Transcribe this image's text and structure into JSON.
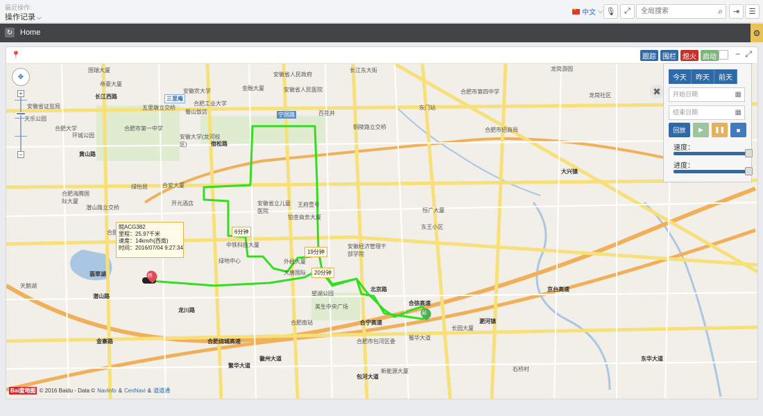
{
  "topbar": {
    "recent_label": "最近操作:",
    "op_log": "操作记录",
    "lang": "中文",
    "search_placeholder": "全局搜索"
  },
  "tabbar": {
    "home": "Home"
  },
  "panel": {
    "buttons": {
      "track": "跟踪",
      "fence": "围栏",
      "fire": "熄火",
      "start": "启动"
    }
  },
  "info_box": {
    "device": "皖ACG382",
    "mileage": "里程：25.97千米",
    "speed": "速度：14km/h(西南)",
    "time": "时间：2016/07/04 9:27:34"
  },
  "time_labels": [
    "6分钟",
    "19分钟",
    "20分钟"
  ],
  "markers": {
    "end": "终",
    "start": "起"
  },
  "playback": {
    "day_tabs": [
      "今天",
      "昨天",
      "前天"
    ],
    "start_placeholder": "开始日期",
    "end_placeholder": "结束日期",
    "replay": "回放",
    "speed_label": "速度：",
    "progress_label": "进度：",
    "speed_value": 1.0,
    "progress_value": 1.0
  },
  "copyright": {
    "logo": "Bai度地图",
    "text": "© 2016 Baidu - Data ©",
    "navinfo": "NavInfo",
    "amp": "&",
    "cennavi": "CenNavi",
    "daodao": "道道通"
  },
  "map_places": [
    "国瑞大厦",
    "安徽省人民政府",
    "长江东大街",
    "龙岗游园",
    "帝豪大厦",
    "安徽农大学",
    "金融大厦",
    "安徽省人民医院",
    "合肥市第四中学",
    "合肥工业大学",
    "龙岗社区",
    "三里庵",
    "五里墩立交桥",
    "蜀山饭店",
    "宁国路",
    "东门站",
    "安徽省证监局",
    "合肥市第一中学",
    "百花井",
    "环城公园",
    "天乐公园",
    "合肥市招商局",
    "铜陵路立交桥",
    "合肥大学",
    "黄山路",
    "安徽大学(龙河校区)",
    "大兴镇",
    "绿怡居",
    "合安大厦",
    "安徽省立儿童医院",
    "王府壹号",
    "恒广大厦",
    "合肥海腾国际大厦",
    "潜山路立交桥",
    "开元酒店",
    "铂金商务大厦",
    "东王小区",
    "合肥市第二人民医院",
    "中铁科技大厦",
    "安徽经济管理干部学院",
    "翡翠湖",
    "绿地中心",
    "外经大厦",
    "天鹅湖",
    "望湖公园",
    "大唐国际",
    "淝河镇",
    "长园大厦",
    "美生中央广场",
    "合肥市包河区委",
    "蜀华大道",
    "合肥南站",
    "徽州大道",
    "新能源大厦",
    "石桥村",
    "东华大道",
    "合宁高速",
    "繁华大道",
    "京台高速",
    "合肥绕城高速",
    "合徐高速",
    "宿松路",
    "金寨路",
    "潜山路",
    "长江西路",
    "龙川路",
    "包河大道",
    "北京路"
  ]
}
